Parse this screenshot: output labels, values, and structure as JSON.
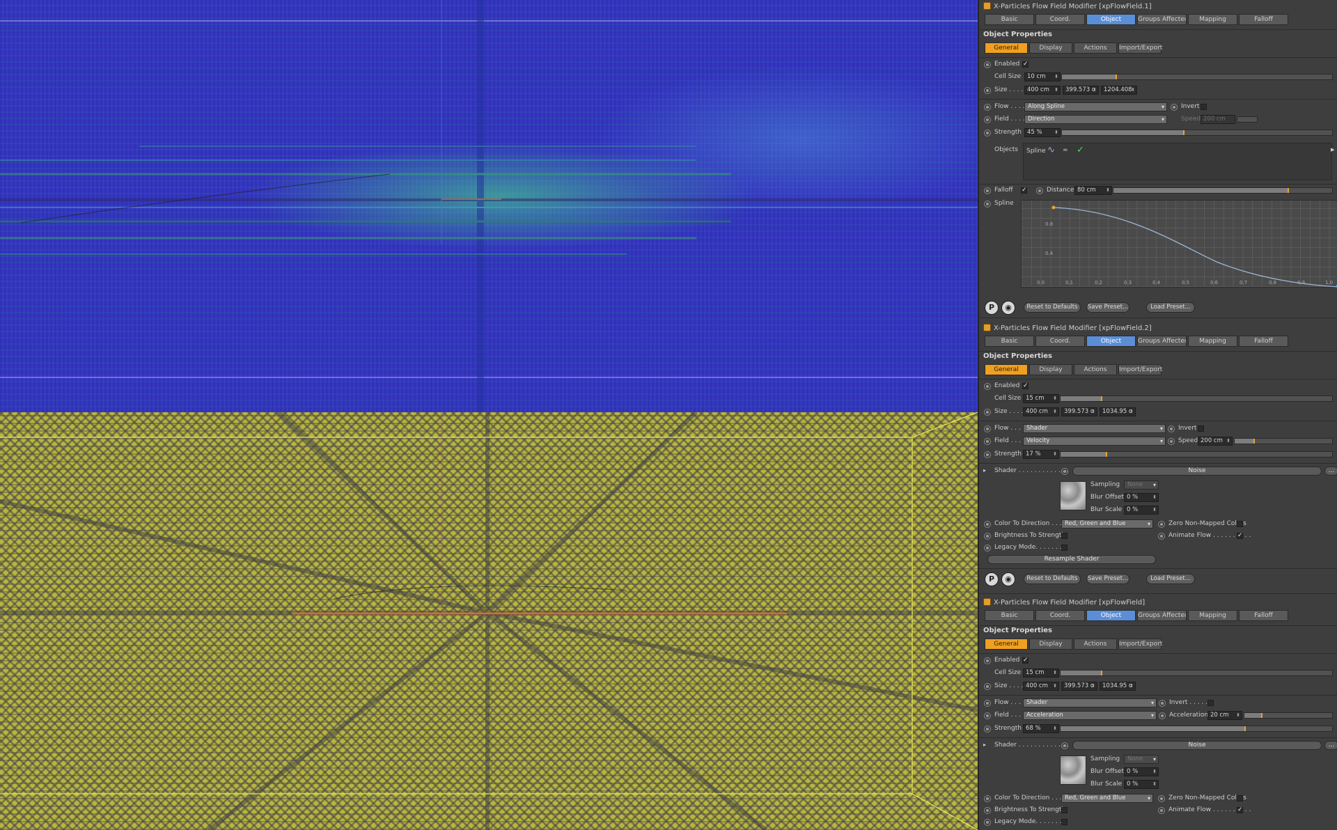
{
  "modifiers": [
    {
      "title": "X-Particles Flow Field Modifier [xpFlowField.1]",
      "tabs": [
        "Basic",
        "Coord.",
        "Object",
        "Groups Affected",
        "Mapping",
        "Falloff"
      ],
      "section": "Object Properties",
      "subtabs": [
        "General",
        "Display",
        "Actions",
        "Import/Export"
      ],
      "enabled_label": "Enabled",
      "cellsize_label": "Cell Size",
      "cellsize": "10 cm",
      "size_label": "Size . . . .",
      "size": [
        "400 cm",
        "399.573 c",
        "1204.408"
      ],
      "flow_label": "Flow . . . .",
      "flow": "Along Spline",
      "invert_label": "Invert",
      "field_label": "Field . . . .",
      "field": "Direction",
      "speed_label": "Speed",
      "speed": "200 cm",
      "strength_label": "Strength",
      "strength": "45 %",
      "objects_label": "Objects",
      "objects_item": "Spline",
      "falloff_label": "Falloff",
      "distance_label": "Distance",
      "distance": "80 cm",
      "spline_label": "Spline",
      "graph_y": [
        "0.8",
        "0.4"
      ],
      "graph_x": [
        "0.0",
        "0.1",
        "0.2",
        "0.3",
        "0.4",
        "0.5",
        "0.6",
        "0.7",
        "0.8",
        "0.9",
        "1.0"
      ],
      "buttons": [
        "Reset to Defaults",
        "Save Preset...",
        "Load Preset..."
      ]
    },
    {
      "title": "X-Particles Flow Field Modifier [xpFlowField.2]",
      "tabs": [
        "Basic",
        "Coord.",
        "Object",
        "Groups Affected",
        "Mapping",
        "Falloff"
      ],
      "section": "Object Properties",
      "subtabs": [
        "General",
        "Display",
        "Actions",
        "Import/Export"
      ],
      "enabled_label": "Enabled",
      "cellsize_label": "Cell Size",
      "cellsize": "15 cm",
      "size_label": "Size . . . .",
      "size": [
        "400 cm",
        "399.573 c",
        "1034.95 c"
      ],
      "flow_label": "Flow . . . .",
      "flow": "Shader",
      "invert_label": "Invert",
      "field_label": "Field . . . .",
      "field": "Velocity",
      "speed_label": "Speed",
      "speed": "200 cm",
      "strength_label": "Strength",
      "strength": "17 %",
      "shader_label": "Shader . . . . . . . . . . . . .",
      "shader": "Noise",
      "sampling_label": "Sampling",
      "sampling": "None",
      "bluroffset_label": "Blur Offset",
      "bluroffset": "0 %",
      "blurscale_label": "Blur Scale",
      "blurscale": "0 %",
      "colordir_label": "Color To Direction . . .",
      "colordir": "Red, Green and Blue",
      "zero_label": "Zero Non-Mapped Colors",
      "bright_label": "Brightness To Strength",
      "animate_label": "Animate Flow . . . . . . . . . .",
      "legacy_label": "Legacy Mode. . . . . . . .",
      "resample": "Resample Shader",
      "buttons": [
        "Reset to Defaults",
        "Save Preset...",
        "Load Preset..."
      ]
    },
    {
      "title": "X-Particles Flow Field Modifier [xpFlowField]",
      "tabs": [
        "Basic",
        "Coord.",
        "Object",
        "Groups Affected",
        "Mapping",
        "Falloff"
      ],
      "section": "Object Properties",
      "subtabs": [
        "General",
        "Display",
        "Actions",
        "Import/Export"
      ],
      "enabled_label": "Enabled",
      "cellsize_label": "Cell Size",
      "cellsize": "15 cm",
      "size_label": "Size . . . .",
      "size": [
        "400 cm",
        "399.573 c",
        "1034.95 c"
      ],
      "flow_label": "Flow . . . .",
      "flow": "Shader",
      "invert_label": "Invert . . . . .",
      "field_label": "Field . . . .",
      "field": "Acceleration",
      "accel_label": "Acceleration",
      "accel": "20 cm",
      "strength_label": "Strength",
      "strength": "68 %",
      "shader_label": "Shader . . . . . . . . . . . . .",
      "shader": "Noise",
      "sampling_label": "Sampling",
      "sampling": "None",
      "bluroffset_label": "Blur Offset",
      "bluroffset": "0 %",
      "blurscale_label": "Blur Scale",
      "blurscale": "0 %",
      "colordir_label": "Color To Direction . . .",
      "colordir": "Red, Green and Blue",
      "zero_label": "Zero Non-Mapped Colors",
      "bright_label": "Brightness To Strength",
      "animate_label": "Animate Flow . . . . . . . . . .",
      "legacy_label": "Legacy Mode. . . . . . . ."
    }
  ],
  "levels": {
    "cellsize1": 0.2,
    "strength1": 0.45,
    "distance1": 0.8,
    "cellsize2": 0.15,
    "speed2": 0.2,
    "strength2": 0.17,
    "cellsize3": 0.15,
    "accel3": 0.2,
    "strength3": 0.68
  },
  "colors": {
    "accent": "#f0a020",
    "active_tab": "#5a8fd8",
    "viewport_top": "#3737c4",
    "viewport_bottom": "#b9b53f"
  }
}
